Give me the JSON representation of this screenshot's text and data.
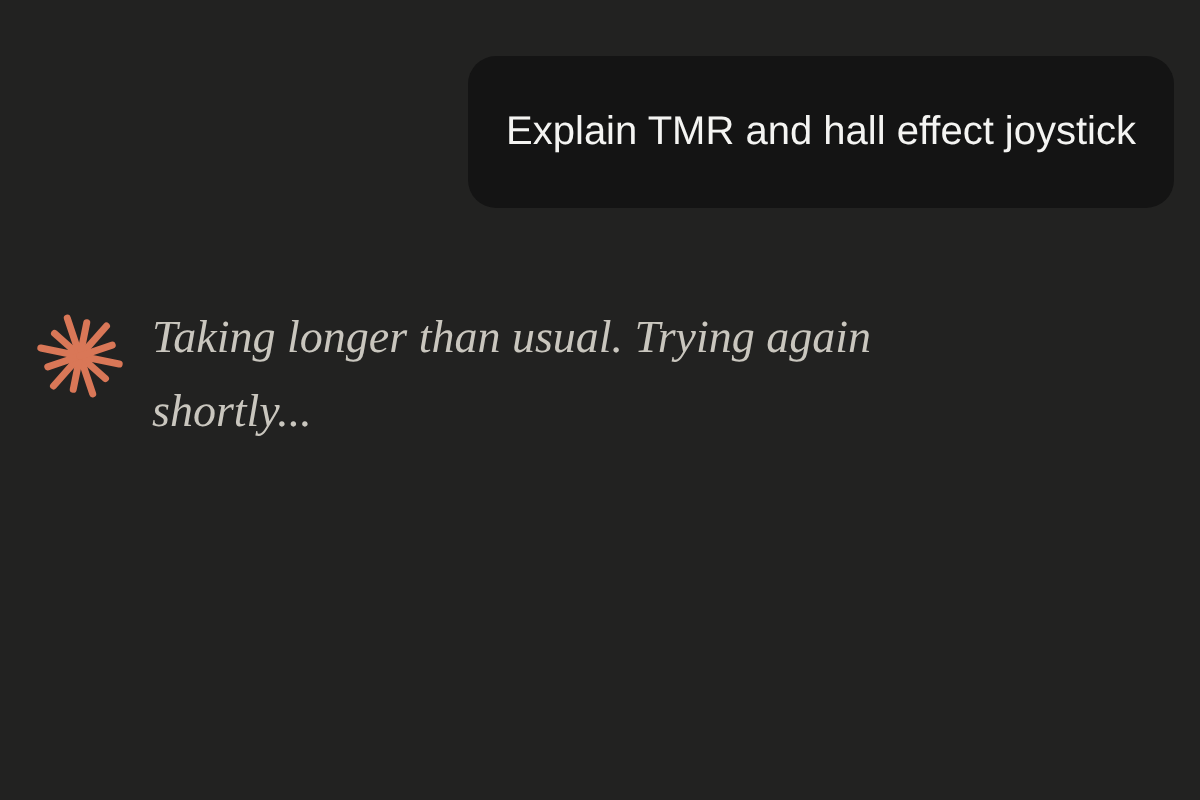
{
  "messages": [
    {
      "kind": "user",
      "text": "Explain TMR and hall effect joystick"
    },
    {
      "kind": "assistant",
      "text": "Taking longer than usual. Trying again shortly..."
    }
  ]
}
